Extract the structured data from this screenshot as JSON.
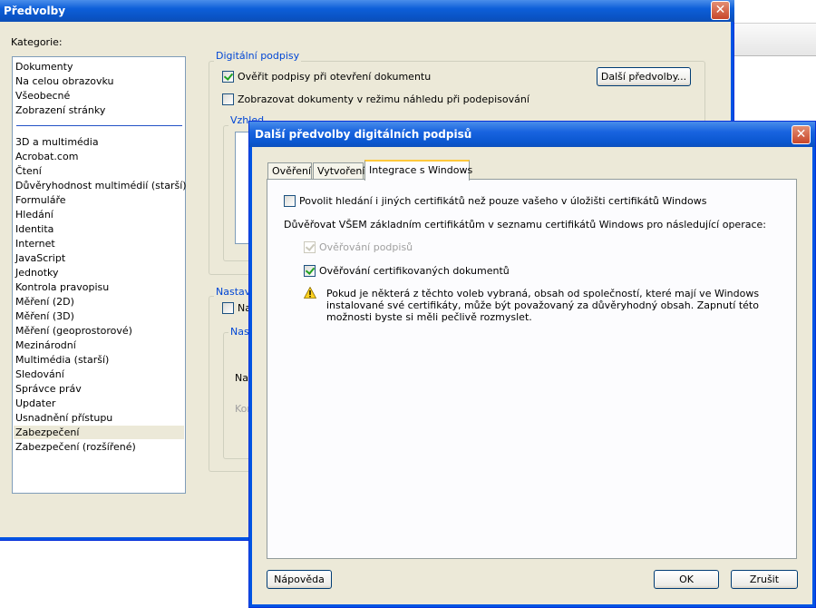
{
  "main_window": {
    "title": "Předvolby",
    "close_glyph": "✕",
    "categories_label": "Kategorie:",
    "categories_top": [
      "Dokumenty",
      "Na celou obrazovku",
      "Všeobecné",
      "Zobrazení stránky"
    ],
    "categories": [
      "3D a multimédia",
      "Acrobat.com",
      "Čtení",
      "Důvěryhodnost multimédií (starší)",
      "Formuláře",
      "Hledání",
      "Identita",
      "Internet",
      "JavaScript",
      "Jednotky",
      "Kontrola pravopisu",
      "Měření (2D)",
      "Měření (3D)",
      "Měření (geoprostorové)",
      "Mezinárodní",
      "Multimédia (starší)",
      "Sledování",
      "Správce práv",
      "Updater",
      "Usnadnění přístupu",
      "Zabezpečení",
      "Zabezpečení (rozšířené)"
    ],
    "selected_category": "Zabezpečení",
    "digital_signatures": {
      "group_title": "Digitální podpisy",
      "verify_on_open": "Ověřit podpisy při otevření dokumentu",
      "verify_on_open_checked": true,
      "preview_mode": "Zobrazovat dokumenty v režimu náhledu při podepisování",
      "preview_mode_checked": false,
      "more_prefs_button": "Další předvolby...",
      "appearance_group_partial": "Vzhled"
    },
    "security_group_partial": "Nastave",
    "security_checkbox_partial": "Na",
    "inner_group_partial": "Nast",
    "inner_label_1_partial": "Nas",
    "inner_label_2_partial": "Kor"
  },
  "dialog": {
    "title": "Další předvolby digitálních podpisů",
    "close_glyph": "✕",
    "tabs": [
      "Ověření",
      "Vytvoření",
      "Integrace s Windows"
    ],
    "active_tab": "Integrace s Windows",
    "allow_search_label": "Povolit hledání i jiných certifikátů než pouze vašeho v úložišti certifikátů Windows",
    "allow_search_checked": false,
    "trust_label": "Důvěřovat VŠEM základním certifikátům v seznamu certifikátů Windows pro následující operace:",
    "validate_signatures_label": "Ověřování podpisů",
    "validate_signatures_checked": true,
    "validate_signatures_disabled": true,
    "validate_certified_label": "Ověřování certifikovaných dokumentů",
    "validate_certified_checked": true,
    "warning_icon": "warning-icon",
    "warning_text": "Pokud je některá z těchto voleb vybraná, obsah od společností, které mají ve Windows instalované své certifikáty, může být považovaný za důvěryhodný obsah. Zapnutí této možnosti byste si měli pečlivě rozmyslet.",
    "help_button": "Nápověda",
    "ok_button": "OK",
    "cancel_button": "Zrušit"
  },
  "colors": {
    "titlebar_blue": "#0a53c4",
    "dialog_face": "#ece9d8",
    "group_title_blue": "#0046d5",
    "close_red": "#c8462a",
    "tab_highlight": "#ffc83c"
  }
}
